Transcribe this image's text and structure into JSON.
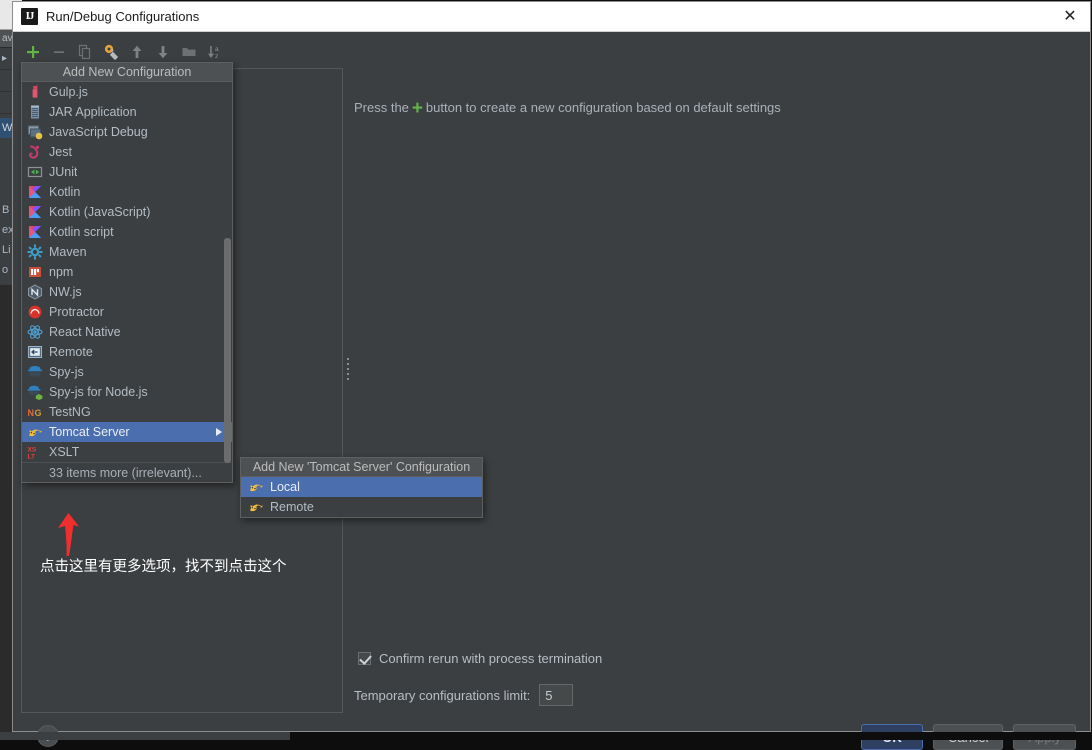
{
  "window": {
    "title": "Run/Debug Configurations",
    "app_icon": "intellij-idea-icon",
    "close_label": "✕"
  },
  "toolbar": {
    "buttons": [
      {
        "name": "add-configuration-button",
        "icon": "plus-icon",
        "enabled": true
      },
      {
        "name": "remove-configuration-button",
        "icon": "minus-icon",
        "enabled": false
      },
      {
        "name": "copy-configuration-button",
        "icon": "copy-icon",
        "enabled": false
      },
      {
        "name": "edit-templates-button",
        "icon": "wrench-gear-icon",
        "enabled": true
      },
      {
        "name": "move-up-button",
        "icon": "arrow-up-icon",
        "enabled": false
      },
      {
        "name": "move-down-button",
        "icon": "arrow-down-icon",
        "enabled": false
      },
      {
        "name": "new-folder-button",
        "icon": "folder-icon",
        "enabled": false
      },
      {
        "name": "sort-alphabetically-button",
        "icon": "sort-az-icon",
        "enabled": false
      }
    ]
  },
  "popup": {
    "header": "Add New Configuration",
    "items": [
      {
        "label": "Gulp.js",
        "icon": "gulp-icon",
        "selected": false,
        "has_submenu": false
      },
      {
        "label": "JAR Application",
        "icon": "jar-icon",
        "selected": false,
        "has_submenu": false
      },
      {
        "label": "JavaScript Debug",
        "icon": "javascript-debug-icon",
        "selected": false,
        "has_submenu": false
      },
      {
        "label": "Jest",
        "icon": "jest-icon",
        "selected": false,
        "has_submenu": false
      },
      {
        "label": "JUnit",
        "icon": "junit-icon",
        "selected": false,
        "has_submenu": false
      },
      {
        "label": "Kotlin",
        "icon": "kotlin-icon",
        "selected": false,
        "has_submenu": false
      },
      {
        "label": "Kotlin (JavaScript)",
        "icon": "kotlin-icon",
        "selected": false,
        "has_submenu": false
      },
      {
        "label": "Kotlin script",
        "icon": "kotlin-icon",
        "selected": false,
        "has_submenu": false
      },
      {
        "label": "Maven",
        "icon": "maven-icon",
        "selected": false,
        "has_submenu": false
      },
      {
        "label": "npm",
        "icon": "npm-icon",
        "selected": false,
        "has_submenu": false
      },
      {
        "label": "NW.js",
        "icon": "nwjs-icon",
        "selected": false,
        "has_submenu": false
      },
      {
        "label": "Protractor",
        "icon": "protractor-icon",
        "selected": false,
        "has_submenu": false
      },
      {
        "label": "React Native",
        "icon": "react-native-icon",
        "selected": false,
        "has_submenu": false
      },
      {
        "label": "Remote",
        "icon": "remote-icon",
        "selected": false,
        "has_submenu": false
      },
      {
        "label": "Spy-js",
        "icon": "spyjs-icon",
        "selected": false,
        "has_submenu": false
      },
      {
        "label": "Spy-js for Node.js",
        "icon": "spyjs-node-icon",
        "selected": false,
        "has_submenu": false
      },
      {
        "label": "TestNG",
        "icon": "testng-icon",
        "selected": false,
        "has_submenu": false
      },
      {
        "label": "Tomcat Server",
        "icon": "tomcat-icon",
        "selected": true,
        "has_submenu": true
      },
      {
        "label": "XSLT",
        "icon": "xslt-icon",
        "selected": false,
        "has_submenu": false
      }
    ],
    "more_item": "33 items more (irrelevant)..."
  },
  "submenu": {
    "header": "Add New 'Tomcat Server' Configuration",
    "items": [
      {
        "label": "Local",
        "icon": "tomcat-icon",
        "selected": true
      },
      {
        "label": "Remote",
        "icon": "tomcat-icon",
        "selected": false
      }
    ]
  },
  "main": {
    "hint_before": "Press the",
    "hint_plus": "+",
    "hint_after": "button to create a new configuration based on default settings",
    "confirm_rerun_label": "Confirm rerun with process termination",
    "confirm_rerun_checked": true,
    "temp_limit_label": "Temporary configurations limit:",
    "temp_limit_value": "5"
  },
  "footer": {
    "help_label": "?",
    "ok_label": "OK",
    "cancel_label": "Cancel",
    "apply_label": "Apply",
    "apply_enabled": false
  },
  "annotation": {
    "text": "点击这里有更多选项，找不到点击这个",
    "arrow_color": "#ef2f2f"
  },
  "background_ide": {
    "tab_label": "av",
    "tool_labels": [
      "B",
      "ex",
      "Li",
      "o"
    ],
    "selected_label": "W"
  },
  "colors": {
    "dialog_bg": "#3c3f41",
    "titlebar_bg": "#ffffff",
    "selection_blue": "#4b6eaf",
    "accent_green": "#62b543",
    "text": "#b7bec5",
    "arrow_red": "#ef2f2f"
  }
}
